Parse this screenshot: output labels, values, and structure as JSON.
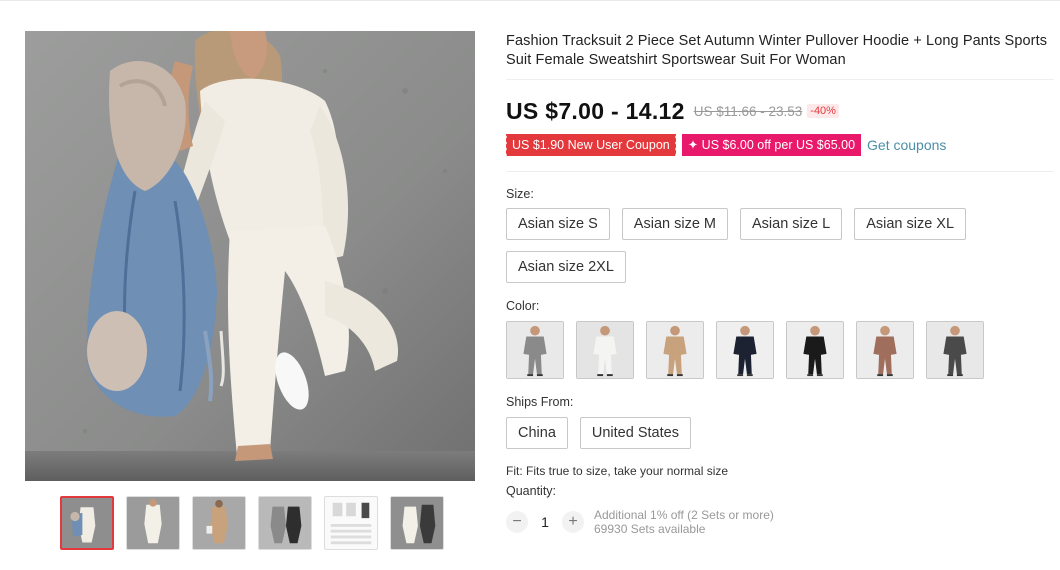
{
  "product": {
    "title": "Fashion Tracksuit 2 Piece Set Autumn Winter Pullover Hoodie + Long Pants Sports Suit Female Sweatshirt Sportswear Suit For Woman",
    "price": "US $7.00 - 14.12",
    "original_price": "US $11.66 - 23.53",
    "discount": "-40%"
  },
  "coupons": {
    "new_user": "US $1.90 New User Coupon",
    "store": "✦ US $6.00 off per US $65.00",
    "get_link": "Get coupons"
  },
  "size": {
    "label": "Size:",
    "options": [
      "Asian size S",
      "Asian size M",
      "Asian size L",
      "Asian size XL",
      "Asian size 2XL"
    ]
  },
  "color": {
    "label": "Color:",
    "swatches": [
      {
        "name": "grey",
        "top": "#8a8a8a",
        "pants": "#8a8a8a",
        "bg": "#e9e9e9"
      },
      {
        "name": "white",
        "top": "#f4f4f2",
        "pants": "#f4f4f2",
        "bg": "#e4e4e4"
      },
      {
        "name": "khaki",
        "top": "#c8a27c",
        "pants": "#c8a27c",
        "bg": "#ececec"
      },
      {
        "name": "navy",
        "top": "#1d2233",
        "pants": "#1d2233",
        "bg": "#efefef"
      },
      {
        "name": "black",
        "top": "#1a1a1a",
        "pants": "#1a1a1a",
        "bg": "#ededed"
      },
      {
        "name": "brown",
        "top": "#a06e5c",
        "pants": "#a06e5c",
        "bg": "#ececec"
      },
      {
        "name": "dark-grey",
        "top": "#4a4a4a",
        "pants": "#4a4a4a",
        "bg": "#e8e8e8"
      }
    ]
  },
  "ships_from": {
    "label": "Ships From:",
    "options": [
      "China",
      "United States"
    ]
  },
  "fit": "Fit: Fits true to size, take your normal size",
  "quantity": {
    "label": "Quantity:",
    "value": "1",
    "minus": "−",
    "plus": "+",
    "additional_offer": "Additional 1% off (2 Sets or more)",
    "available": "69930 Sets available"
  },
  "thumbnails": [
    {
      "name": "denim-jacket",
      "active": true
    },
    {
      "name": "white-set"
    },
    {
      "name": "khaki-set"
    },
    {
      "name": "grey-set"
    },
    {
      "name": "size-chart"
    },
    {
      "name": "white-set-alt"
    }
  ]
}
